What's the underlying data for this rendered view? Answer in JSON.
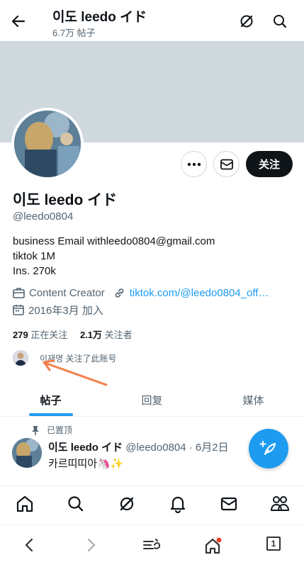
{
  "header": {
    "title": "이도 leedo イド",
    "post_count": "6.7万 帖子"
  },
  "profile": {
    "name": "이도 leedo イド",
    "handle": "@leedo0804",
    "follow_label": "关注",
    "bio": "business Email withleedo0804@gmail.com\ntiktok 1M\nIns. 270k",
    "category": "Content Creator",
    "website": "tiktok.com/@leedo0804_off…",
    "joined": "2016年3月 加入",
    "following_count": "279",
    "following_label": "正在关注",
    "followers_count": "2.1万",
    "followers_label": "关注者",
    "followed_by": "이재명 关注了此账号"
  },
  "tabs": [
    "帖子",
    "回复",
    "媒体"
  ],
  "pinned_post": {
    "pinned_label": "已置顶",
    "name": "이도 leedo イド",
    "meta": "@leedo0804 · 6月2日",
    "text": "카르띠띠아🦄✨"
  },
  "colors": {
    "accent": "#1d9bf0",
    "banner": "#cfd9de",
    "arrow": "#f0804a"
  },
  "system_nav": {
    "tab_count": "1"
  }
}
